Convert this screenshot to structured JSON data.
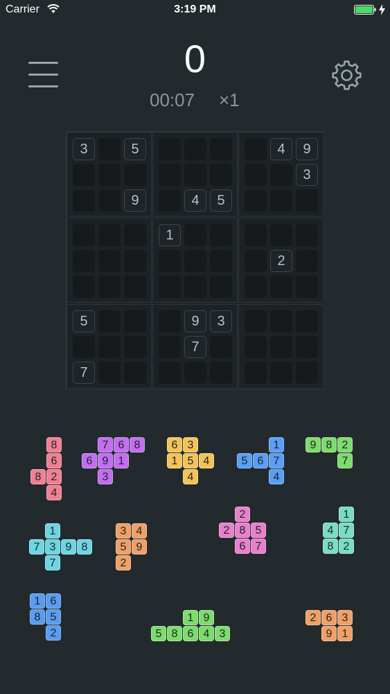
{
  "status": {
    "carrier": "Carrier",
    "time": "3:19 PM"
  },
  "header": {
    "score": "0",
    "timer": "00:07",
    "multiplier": "×1"
  },
  "board": {
    "cells": [
      {
        "r": 0,
        "c": 0,
        "v": "3"
      },
      {
        "r": 0,
        "c": 2,
        "v": "5"
      },
      {
        "r": 0,
        "c": 7,
        "v": "4"
      },
      {
        "r": 0,
        "c": 8,
        "v": "9"
      },
      {
        "r": 1,
        "c": 8,
        "v": "3"
      },
      {
        "r": 2,
        "c": 2,
        "v": "9"
      },
      {
        "r": 2,
        "c": 4,
        "v": "4"
      },
      {
        "r": 2,
        "c": 5,
        "v": "5"
      },
      {
        "r": 3,
        "c": 3,
        "v": "1"
      },
      {
        "r": 4,
        "c": 7,
        "v": "2"
      },
      {
        "r": 6,
        "c": 0,
        "v": "5"
      },
      {
        "r": 6,
        "c": 4,
        "v": "9"
      },
      {
        "r": 6,
        "c": 5,
        "v": "3"
      },
      {
        "r": 7,
        "c": 4,
        "v": "7"
      },
      {
        "r": 8,
        "c": 0,
        "v": "7"
      }
    ]
  },
  "pieces": [
    {
      "name": "piece-pink",
      "color": "pink",
      "cells": [
        [
          0,
          1,
          "8"
        ],
        [
          1,
          1,
          "6"
        ],
        [
          2,
          0,
          "8"
        ],
        [
          2,
          1,
          "2"
        ],
        [
          3,
          1,
          "4"
        ]
      ]
    },
    {
      "name": "piece-purple",
      "color": "purple",
      "cells": [
        [
          0,
          1,
          "7"
        ],
        [
          0,
          2,
          "6"
        ],
        [
          0,
          3,
          "8"
        ],
        [
          1,
          0,
          "6"
        ],
        [
          1,
          1,
          "9"
        ],
        [
          1,
          2,
          "1"
        ],
        [
          2,
          1,
          "3"
        ]
      ]
    },
    {
      "name": "piece-yellow",
      "color": "yellow",
      "cells": [
        [
          0,
          0,
          "6"
        ],
        [
          0,
          1,
          "3"
        ],
        [
          1,
          0,
          "1"
        ],
        [
          1,
          1,
          "5"
        ],
        [
          1,
          2,
          "4"
        ],
        [
          2,
          1,
          "4"
        ]
      ]
    },
    {
      "name": "piece-blue",
      "color": "blue",
      "cells": [
        [
          0,
          2,
          "1"
        ],
        [
          1,
          0,
          "5"
        ],
        [
          1,
          1,
          "6"
        ],
        [
          1,
          2,
          "7"
        ],
        [
          2,
          2,
          "4"
        ]
      ]
    },
    {
      "name": "piece-green",
      "color": "green",
      "cells": [
        [
          0,
          0,
          "9"
        ],
        [
          0,
          1,
          "8"
        ],
        [
          0,
          2,
          "2"
        ],
        [
          1,
          2,
          "7"
        ]
      ]
    },
    {
      "name": "piece-cyan",
      "color": "cyan",
      "cells": [
        [
          0,
          1,
          "1"
        ],
        [
          1,
          0,
          "7"
        ],
        [
          1,
          1,
          "3"
        ],
        [
          1,
          2,
          "9"
        ],
        [
          1,
          3,
          "8"
        ],
        [
          2,
          1,
          "7"
        ]
      ]
    },
    {
      "name": "piece-orange",
      "color": "orange",
      "cells": [
        [
          0,
          0,
          "3"
        ],
        [
          0,
          1,
          "4"
        ],
        [
          1,
          0,
          "5"
        ],
        [
          1,
          1,
          "9"
        ],
        [
          2,
          0,
          "2"
        ]
      ]
    },
    {
      "name": "piece-pink2",
      "color": "pink2",
      "cells": [
        [
          0,
          1,
          "2"
        ],
        [
          1,
          0,
          "2"
        ],
        [
          1,
          1,
          "8"
        ],
        [
          1,
          2,
          "5"
        ],
        [
          2,
          1,
          "6"
        ],
        [
          2,
          2,
          "7"
        ]
      ]
    },
    {
      "name": "piece-mint",
      "color": "mint",
      "cells": [
        [
          0,
          1,
          "1"
        ],
        [
          1,
          0,
          "4"
        ],
        [
          1,
          1,
          "7"
        ],
        [
          2,
          0,
          "8"
        ],
        [
          2,
          1,
          "2"
        ]
      ]
    },
    {
      "name": "piece-blue2",
      "color": "blue2",
      "cells": [
        [
          0,
          0,
          "1"
        ],
        [
          0,
          1,
          "6"
        ],
        [
          1,
          0,
          "8"
        ],
        [
          1,
          1,
          "5"
        ],
        [
          2,
          1,
          "2"
        ]
      ]
    },
    {
      "name": "piece-green2",
      "color": "green",
      "cells": [
        [
          0,
          2,
          "1"
        ],
        [
          0,
          3,
          "9"
        ],
        [
          1,
          0,
          "5"
        ],
        [
          1,
          1,
          "8"
        ],
        [
          1,
          2,
          "6"
        ],
        [
          1,
          3,
          "4"
        ],
        [
          1,
          4,
          "3"
        ]
      ]
    },
    {
      "name": "piece-orange2",
      "color": "orange",
      "cells": [
        [
          0,
          0,
          "2"
        ],
        [
          0,
          1,
          "6"
        ],
        [
          0,
          2,
          "3"
        ],
        [
          1,
          1,
          "9"
        ],
        [
          1,
          2,
          "1"
        ]
      ]
    }
  ]
}
